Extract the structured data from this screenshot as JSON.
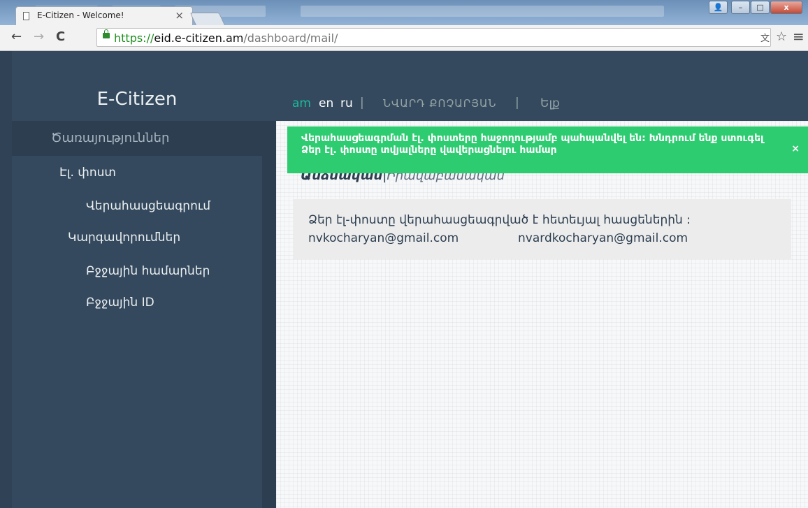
{
  "browser": {
    "tab_title": "E-Citizen - Welcome!",
    "tab_close": "×",
    "url_https": "https://",
    "url_host": "eid.e-citizen.am",
    "url_path": "/dashboard/mail/",
    "window_buttons": {
      "user": "👤",
      "minimize": "–",
      "maximize": "□",
      "close": "x"
    },
    "toolbar_icons": {
      "back": "←",
      "forward": "→",
      "reload": "C",
      "translate": "文",
      "star": "☆",
      "menu": "≡"
    }
  },
  "sidebar": {
    "brand": "E-Citizen",
    "active_section": "Ծառայություններ",
    "items": [
      {
        "label": "Էլ. փոստ"
      },
      {
        "label": "Վերահասցեագրում"
      },
      {
        "label": "Կարգավորումներ"
      },
      {
        "label": "Բջջային համարներ"
      },
      {
        "label": "Բջջային ID"
      }
    ]
  },
  "topnav": {
    "lang_am": "am",
    "lang_en": "en",
    "lang_ru": "ru",
    "separator": "|",
    "user_name": "ՆՎԱՐԴ ՔՈՉԱՐՅԱՆ",
    "logout": "Ելք"
  },
  "alert": {
    "message": "Վերահասցեագրման էլ. փոստերը հաջողությամբ պահպանվել են: Խնդրում ենք ստուգել Ձեր էլ. փոստը տվյալները վավերացնելու համար",
    "close": "×"
  },
  "subtabs": {
    "personal": "Անձնական",
    "separator": "|",
    "legal": "Իրավաբանական"
  },
  "card": {
    "text": "Ձեր էլ-փոստը վերահասցեագրված է հետեւյալ հասցեներին :",
    "emails": [
      "nvkocharyan@gmail.com",
      "nvardkocharyan@gmail.com"
    ]
  },
  "colors": {
    "sidebar_bg": "#34495e",
    "sidebar_active_bg": "#2c3e50",
    "alert_bg": "#2ecc71",
    "accent_lang": "#1abc9c"
  }
}
